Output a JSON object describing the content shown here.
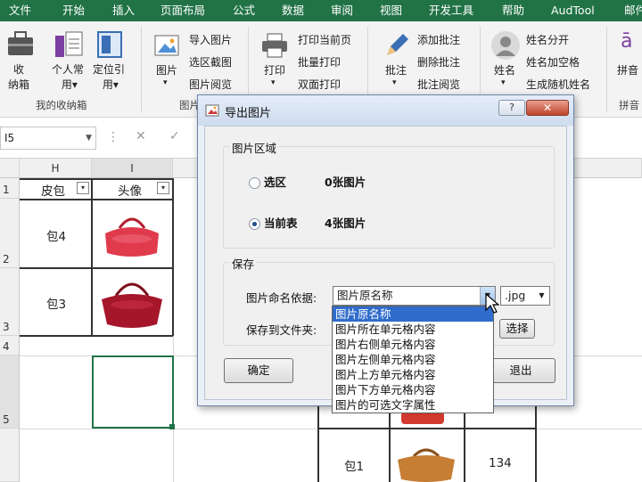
{
  "menubar": {
    "items": [
      "文件",
      "开始",
      "插入",
      "页面布局",
      "公式",
      "数据",
      "审阅",
      "视图",
      "开发工具",
      "帮助",
      "AudTool",
      "邮件"
    ]
  },
  "ribbon": {
    "group_collect": {
      "label": "我的收纳箱",
      "buttons": [
        "收\n纳箱",
        "个人常\n用▾",
        "定位引\n用▾"
      ]
    },
    "picture_button": "图片",
    "picture_items": [
      "导入图片",
      "选区截图",
      "图片阅览"
    ],
    "picture_group_label": "图片",
    "print_button": "打印",
    "print_items": [
      "打印当前页",
      "批量打印",
      "双面打印"
    ],
    "annotate_button": "批注",
    "annotate_items": [
      "添加批注",
      "删除批注",
      "批注阅览"
    ],
    "name_button": "姓名",
    "name_items": [
      "姓名分开",
      "姓名加空格",
      "生成随机姓名"
    ],
    "pinyin_button": "拼音",
    "pinyin_group_label": "拼音"
  },
  "formula_bar": {
    "name_box": "I5",
    "cancel_icon": "✕",
    "confirm_icon": "✓"
  },
  "sheet": {
    "columns": [
      "H",
      "I"
    ],
    "rows": [
      "1",
      "2",
      "3",
      "4",
      "5"
    ],
    "header_h": "皮包",
    "header_i": "头像",
    "cell_bag4": "包4",
    "cell_bag3": "包3",
    "cell_bag1": "包1",
    "cell_num": "134"
  },
  "dialog": {
    "title": "导出图片",
    "help": "?",
    "close": "✕",
    "area_group": "图片区域",
    "option_selection": "选区",
    "selection_count": "0张图片",
    "option_sheet": "当前表",
    "sheet_count": "4张图片",
    "save_group": "保存",
    "naming_label": "图片命名依据:",
    "naming_value": "图片原名称",
    "format_value": ".jpg",
    "folder_label": "保存到文件夹:",
    "choose_button": "选择",
    "ok_button": "确定",
    "exit_button": "退出",
    "naming_options": [
      "图片原名称",
      "图片所在单元格内容",
      "图片右侧单元格内容",
      "图片左侧单元格内容",
      "图片上方单元格内容",
      "图片下方单元格内容",
      "图片的可选文字属性"
    ]
  },
  "colors": {
    "excel_green": "#217346",
    "selection": "#2f6ccb"
  }
}
